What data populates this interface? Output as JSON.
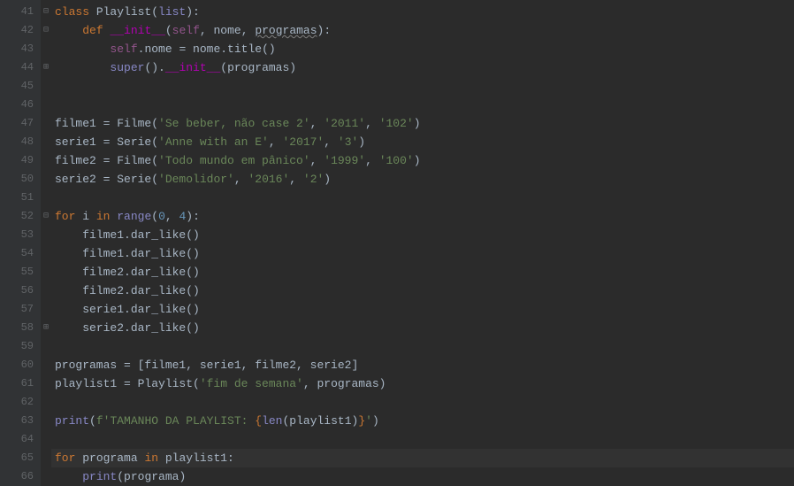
{
  "gutter": {
    "start": 41,
    "end": 66
  },
  "fold_marks": {
    "41": "⊟",
    "42": "⊟",
    "44": "⊞",
    "52": "⊟",
    "58": "⊞"
  },
  "lines": {
    "41": {
      "tokens": [
        {
          "t": "kw",
          "v": "class "
        },
        {
          "t": "ident",
          "v": "Playlist("
        },
        {
          "t": "builtin",
          "v": "list"
        },
        {
          "t": "ident",
          "v": "):"
        }
      ],
      "indent": 0
    },
    "42": {
      "tokens": [
        {
          "t": "kw",
          "v": "def "
        },
        {
          "t": "dunder",
          "v": "__init__"
        },
        {
          "t": "ident",
          "v": "("
        },
        {
          "t": "self",
          "v": "self"
        },
        {
          "t": "ident",
          "v": ", nome, "
        },
        {
          "t": "param",
          "v": "programas",
          "wavy": true
        },
        {
          "t": "ident",
          "v": "):"
        }
      ],
      "indent": 1
    },
    "43": {
      "tokens": [
        {
          "t": "self",
          "v": "self"
        },
        {
          "t": "ident",
          "v": ".nome = nome.title()"
        }
      ],
      "indent": 2
    },
    "44": {
      "tokens": [
        {
          "t": "builtin",
          "v": "super"
        },
        {
          "t": "ident",
          "v": "()."
        },
        {
          "t": "dunder",
          "v": "__init__"
        },
        {
          "t": "ident",
          "v": "(programas)"
        }
      ],
      "indent": 2
    },
    "45": {
      "tokens": [],
      "indent": 0
    },
    "46": {
      "tokens": [],
      "indent": 0
    },
    "47": {
      "tokens": [
        {
          "t": "ident",
          "v": "filme1 = Filme("
        },
        {
          "t": "str",
          "v": "'Se beber, não case 2'"
        },
        {
          "t": "ident",
          "v": ", "
        },
        {
          "t": "str",
          "v": "'2011'"
        },
        {
          "t": "ident",
          "v": ", "
        },
        {
          "t": "str",
          "v": "'102'"
        },
        {
          "t": "ident",
          "v": ")"
        }
      ],
      "indent": 0
    },
    "48": {
      "tokens": [
        {
          "t": "ident",
          "v": "serie1 = Serie("
        },
        {
          "t": "str",
          "v": "'Anne with an E'"
        },
        {
          "t": "ident",
          "v": ", "
        },
        {
          "t": "str",
          "v": "'2017'"
        },
        {
          "t": "ident",
          "v": ", "
        },
        {
          "t": "str",
          "v": "'3'"
        },
        {
          "t": "ident",
          "v": ")"
        }
      ],
      "indent": 0
    },
    "49": {
      "tokens": [
        {
          "t": "ident",
          "v": "filme2 = Filme("
        },
        {
          "t": "str",
          "v": "'Todo mundo em pânico'"
        },
        {
          "t": "ident",
          "v": ", "
        },
        {
          "t": "str",
          "v": "'1999'"
        },
        {
          "t": "ident",
          "v": ", "
        },
        {
          "t": "str",
          "v": "'100'"
        },
        {
          "t": "ident",
          "v": ")"
        }
      ],
      "indent": 0
    },
    "50": {
      "tokens": [
        {
          "t": "ident",
          "v": "serie2 = Serie("
        },
        {
          "t": "str",
          "v": "'Demolidor'"
        },
        {
          "t": "ident",
          "v": ", "
        },
        {
          "t": "str",
          "v": "'2016'"
        },
        {
          "t": "ident",
          "v": ", "
        },
        {
          "t": "str",
          "v": "'2'"
        },
        {
          "t": "ident",
          "v": ")"
        }
      ],
      "indent": 0
    },
    "51": {
      "tokens": [],
      "indent": 0
    },
    "52": {
      "tokens": [
        {
          "t": "kw",
          "v": "for "
        },
        {
          "t": "ident",
          "v": "i "
        },
        {
          "t": "kw",
          "v": "in "
        },
        {
          "t": "builtin",
          "v": "range"
        },
        {
          "t": "ident",
          "v": "("
        },
        {
          "t": "num",
          "v": "0"
        },
        {
          "t": "ident",
          "v": ", "
        },
        {
          "t": "num",
          "v": "4"
        },
        {
          "t": "ident",
          "v": "):"
        }
      ],
      "indent": 0
    },
    "53": {
      "tokens": [
        {
          "t": "ident",
          "v": "filme1.dar_like()"
        }
      ],
      "indent": 1
    },
    "54": {
      "tokens": [
        {
          "t": "ident",
          "v": "filme1.dar_like()"
        }
      ],
      "indent": 1
    },
    "55": {
      "tokens": [
        {
          "t": "ident",
          "v": "filme2.dar_like()"
        }
      ],
      "indent": 1
    },
    "56": {
      "tokens": [
        {
          "t": "ident",
          "v": "filme2.dar_like()"
        }
      ],
      "indent": 1
    },
    "57": {
      "tokens": [
        {
          "t": "ident",
          "v": "serie1.dar_like()"
        }
      ],
      "indent": 1
    },
    "58": {
      "tokens": [
        {
          "t": "ident",
          "v": "serie2.dar_like()"
        }
      ],
      "indent": 1
    },
    "59": {
      "tokens": [],
      "indent": 0
    },
    "60": {
      "tokens": [
        {
          "t": "ident",
          "v": "programas = [filme1, serie1, filme2, serie2]"
        }
      ],
      "indent": 0
    },
    "61": {
      "tokens": [
        {
          "t": "ident",
          "v": "playlist1 = Playlist("
        },
        {
          "t": "str",
          "v": "'fim de semana'"
        },
        {
          "t": "ident",
          "v": ", programas)"
        }
      ],
      "indent": 0
    },
    "62": {
      "tokens": [],
      "indent": 0
    },
    "63": {
      "tokens": [
        {
          "t": "builtin",
          "v": "print"
        },
        {
          "t": "ident",
          "v": "("
        },
        {
          "t": "fstr-prefix",
          "v": "f'"
        },
        {
          "t": "str",
          "v": "TAMANHO DA PLAYLIST: "
        },
        {
          "t": "fstr-brace",
          "v": "{"
        },
        {
          "t": "builtin",
          "v": "len"
        },
        {
          "t": "ident",
          "v": "(playlist1)"
        },
        {
          "t": "fstr-brace",
          "v": "}"
        },
        {
          "t": "str",
          "v": "'"
        },
        {
          "t": "ident",
          "v": ")"
        }
      ],
      "indent": 0
    },
    "64": {
      "tokens": [],
      "indent": 0
    },
    "65": {
      "tokens": [
        {
          "t": "kw",
          "v": "for "
        },
        {
          "t": "ident",
          "v": "programa "
        },
        {
          "t": "kw",
          "v": "in "
        },
        {
          "t": "ident",
          "v": "playlist1:"
        }
      ],
      "indent": 0,
      "current": true
    },
    "66": {
      "tokens": [
        {
          "t": "builtin",
          "v": "print"
        },
        {
          "t": "ident",
          "v": "(programa)"
        }
      ],
      "indent": 1
    }
  }
}
